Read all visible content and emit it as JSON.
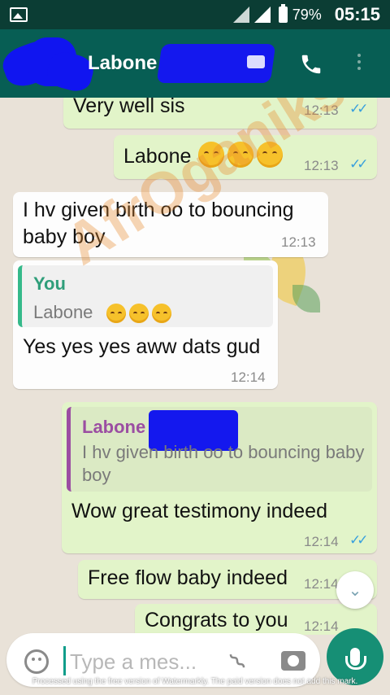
{
  "status_bar": {
    "battery": "79%",
    "time": "05:15"
  },
  "header": {
    "contact_name": "Labone"
  },
  "messages": [
    {
      "text": "Very well sis",
      "time": "12:13"
    },
    {
      "text": "Labone",
      "time": "12:13"
    },
    {
      "text": "I hv given birth oo to bouncing baby boy",
      "time": "12:13"
    },
    {
      "quote_author": "You",
      "quote_text": "Labone",
      "text": "Yes yes yes aww dats gud",
      "time": "12:14"
    },
    {
      "quote_author": "Labone",
      "quote_text": "I hv given birth oo to bouncing baby boy",
      "text": "Wow great testimony indeed",
      "time": "12:14"
    },
    {
      "text": "Free flow baby indeed",
      "time": "12:14"
    },
    {
      "text": "Congrats to you",
      "time": "12:14"
    }
  ],
  "watermark": "AfrOganiks",
  "input": {
    "placeholder": "Type a mes..."
  },
  "footer_note": "Processed using the free version of Watermarkly. The paid version does not add this mark.",
  "colors": {
    "header": "#075e54",
    "status_bar": "#0b3d34",
    "outgoing": "#e2f4c9",
    "incoming": "#fdfdfd",
    "accent": "#168f75",
    "ticks": "#39a0dd"
  },
  "icons": [
    "image-icon",
    "signal-icon",
    "battery-icon",
    "video-call-icon",
    "phone-icon",
    "menu-icon",
    "emoji-icon",
    "attach-icon",
    "camera-icon",
    "mic-icon",
    "scroll-down-icon"
  ]
}
